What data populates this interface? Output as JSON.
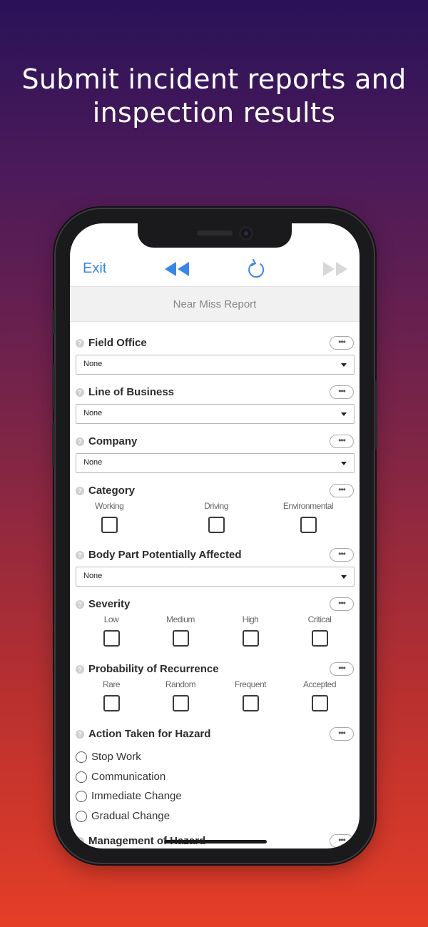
{
  "headline": {
    "line1": "Submit incident reports and",
    "line2": "inspection results"
  },
  "toolbar": {
    "exit_label": "Exit",
    "back_icon": "rewind-icon",
    "refresh_icon": "refresh-icon",
    "forward_icon": "fast-forward-icon",
    "accent_color": "#3a86e6"
  },
  "form": {
    "title": "Near Miss Report",
    "help_glyph": "?",
    "more_glyph": "•••",
    "field_office": {
      "label": "Field Office",
      "value": "None"
    },
    "line_of_business": {
      "label": "Line of Business",
      "value": "None"
    },
    "company": {
      "label": "Company",
      "value": "None"
    },
    "category": {
      "label": "Category",
      "options": [
        "Working",
        "Driving",
        "Environmental"
      ]
    },
    "body_part": {
      "label": "Body Part Potentially Affected",
      "value": "None"
    },
    "severity": {
      "label": "Severity",
      "options": [
        "Low",
        "Medium",
        "High",
        "Critical"
      ]
    },
    "probability": {
      "label": "Probability of Recurrence",
      "options": [
        "Rare",
        "Random",
        "Frequent",
        "Accepted"
      ]
    },
    "action": {
      "label": "Action Taken for Hazard",
      "options": [
        "Stop Work",
        "Communication",
        "Immediate Change",
        "Gradual Change"
      ]
    },
    "management": {
      "label": "Management of Hazard"
    }
  }
}
